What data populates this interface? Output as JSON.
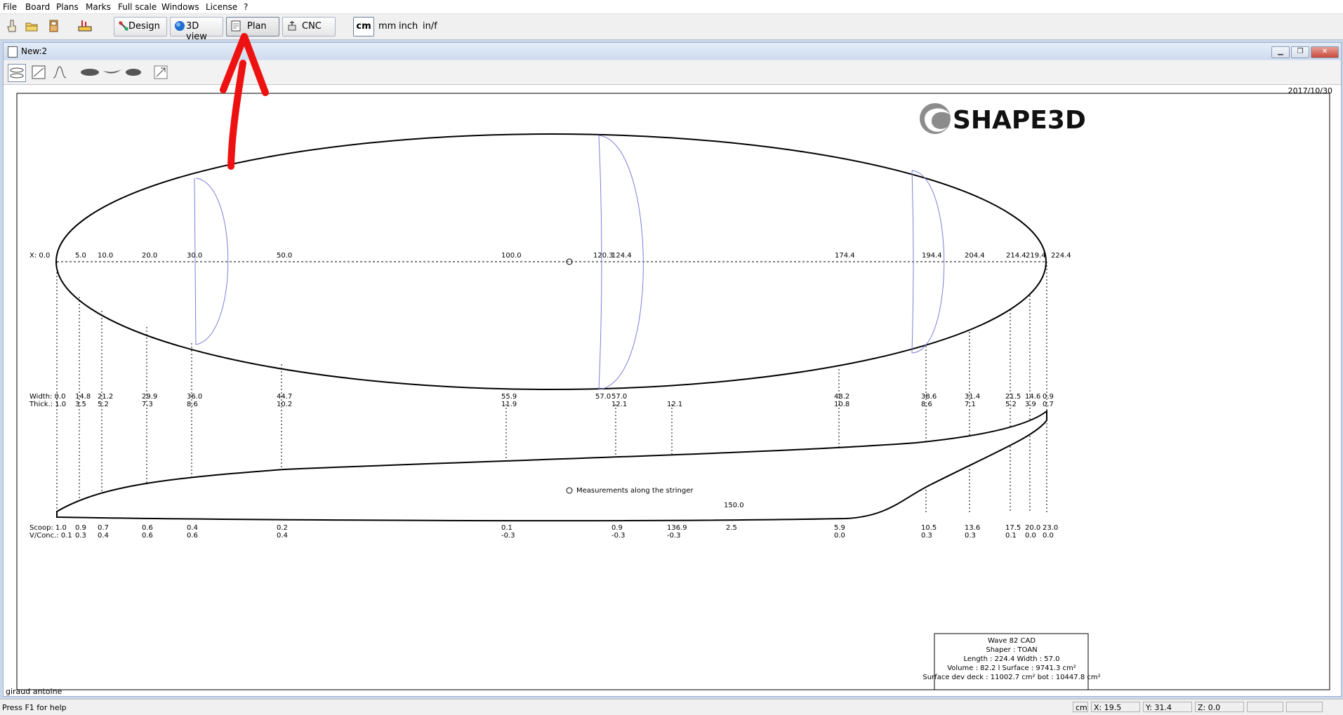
{
  "menu": [
    "File",
    "Board",
    "Plans",
    "Marks",
    "Full scale",
    "Windows",
    "License",
    "?"
  ],
  "toolbar": {
    "design": "Design",
    "view3d": "3D view",
    "plan": "Plan",
    "cnc": "CNC",
    "units": [
      "cm",
      "mm",
      "inch",
      "in/f"
    ],
    "selected_unit": "cm"
  },
  "window": {
    "title": "New:2"
  },
  "plan": {
    "date": "2017/10/30",
    "author": "giraud antoine",
    "logo_text": "SHAPE3D",
    "x_row_label": "X: 0.0",
    "x_labels": [
      "5.0",
      "10.0",
      "20.0",
      "30.0",
      "50.0",
      "100.0",
      "120.3",
      "124.4",
      "174.4",
      "194.4",
      "204.4",
      "214.4",
      "219.4",
      "224.4"
    ],
    "width_row": [
      {
        "w": "Width: 0.0",
        "t": "Thick.: 1.0"
      },
      {
        "w": "14.8",
        "t": "3.5"
      },
      {
        "w": "21.2",
        "t": "5.2"
      },
      {
        "w": "29.9",
        "t": "7.3"
      },
      {
        "w": "36.0",
        "t": "8.6"
      },
      {
        "w": "44.7",
        "t": "10.2"
      },
      {
        "w": "55.9",
        "t": "11.9"
      },
      {
        "w": "57.0",
        "t": ""
      },
      {
        "w": "57.0",
        "t": "12.1"
      },
      {
        "w": "",
        "t": "12.1"
      },
      {
        "w": "48.2",
        "t": "10.8"
      },
      {
        "w": "38.6",
        "t": "8.6"
      },
      {
        "w": "31.4",
        "t": "7.1"
      },
      {
        "w": "21.5",
        "t": "5.2"
      },
      {
        "w": "14.6",
        "t": "3.9"
      },
      {
        "w": "0.9",
        "t": "0.7"
      }
    ],
    "scoop_row": [
      {
        "s": "Scoop: 1.0",
        "v": "V/Conc.: 0.1"
      },
      {
        "s": "0.9",
        "v": "0.3"
      },
      {
        "s": "0.7",
        "v": "0.4"
      },
      {
        "s": "0.6",
        "v": "0.6"
      },
      {
        "s": "0.4",
        "v": "0.6"
      },
      {
        "s": "0.2",
        "v": "0.4"
      },
      {
        "s": "0.1",
        "v": "-0.3"
      },
      {
        "s": "0.9",
        "v": "-0.3"
      },
      {
        "s": "136.9",
        "v": "-0.3"
      },
      {
        "s": "2.5",
        "v": ""
      },
      {
        "s": "5.9",
        "v": "0.0"
      },
      {
        "s": "10.5",
        "v": "0.3"
      },
      {
        "s": "13.6",
        "v": "0.3"
      },
      {
        "s": "17.5",
        "v": "0.1"
      },
      {
        "s": "20.0",
        "v": "0.0"
      },
      {
        "s": "23.0",
        "v": "0.0"
      }
    ],
    "stringer_note": "Measurements along the stringer",
    "stringer_value": "150.0",
    "info": [
      "Wave 82 CAD",
      "Shaper : TOAN",
      "Length : 224.4 Width : 57.0",
      "Volume : 82.2 l Surface : 9741.3 cm²",
      "Surface dev deck : 11002.7 cm² bot : 10447.8 cm²"
    ]
  },
  "status": {
    "help": "Press F1 for help",
    "unit": "cm",
    "x": "X: 19.5",
    "y": "Y: 31.4",
    "z": "Z: 0.0"
  },
  "colors": {
    "annotation_arrow": "#ee1111",
    "section_lines": "#7c7fd6"
  }
}
